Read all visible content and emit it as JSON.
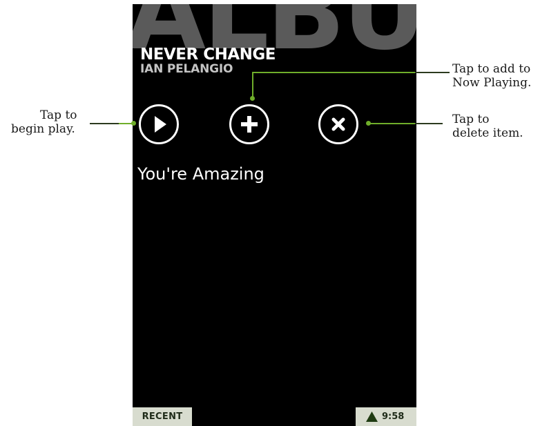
{
  "screen": {
    "background_title": "ALBU",
    "album_title": "NEVER CHANGE",
    "artist": "IAN PELANGIO",
    "song_title": "You're Amazing"
  },
  "buttons": {
    "play_icon": "play-icon",
    "add_icon": "plus-icon",
    "delete_icon": "close-icon"
  },
  "footer": {
    "recent_label": "RECENT",
    "clock": "9:58",
    "signal_icon": "signal-triangle-icon"
  },
  "callouts": {
    "play_line1": "Tap to",
    "play_line2": "begin play.",
    "add_line1": "Tap to add to",
    "add_line2": "Now Playing.",
    "delete_line1": "Tap to",
    "delete_line2": "delete item."
  },
  "colors": {
    "accent_green": "#6fae2a",
    "phone_bg": "#000000",
    "tab_bg": "#d8dccf"
  }
}
